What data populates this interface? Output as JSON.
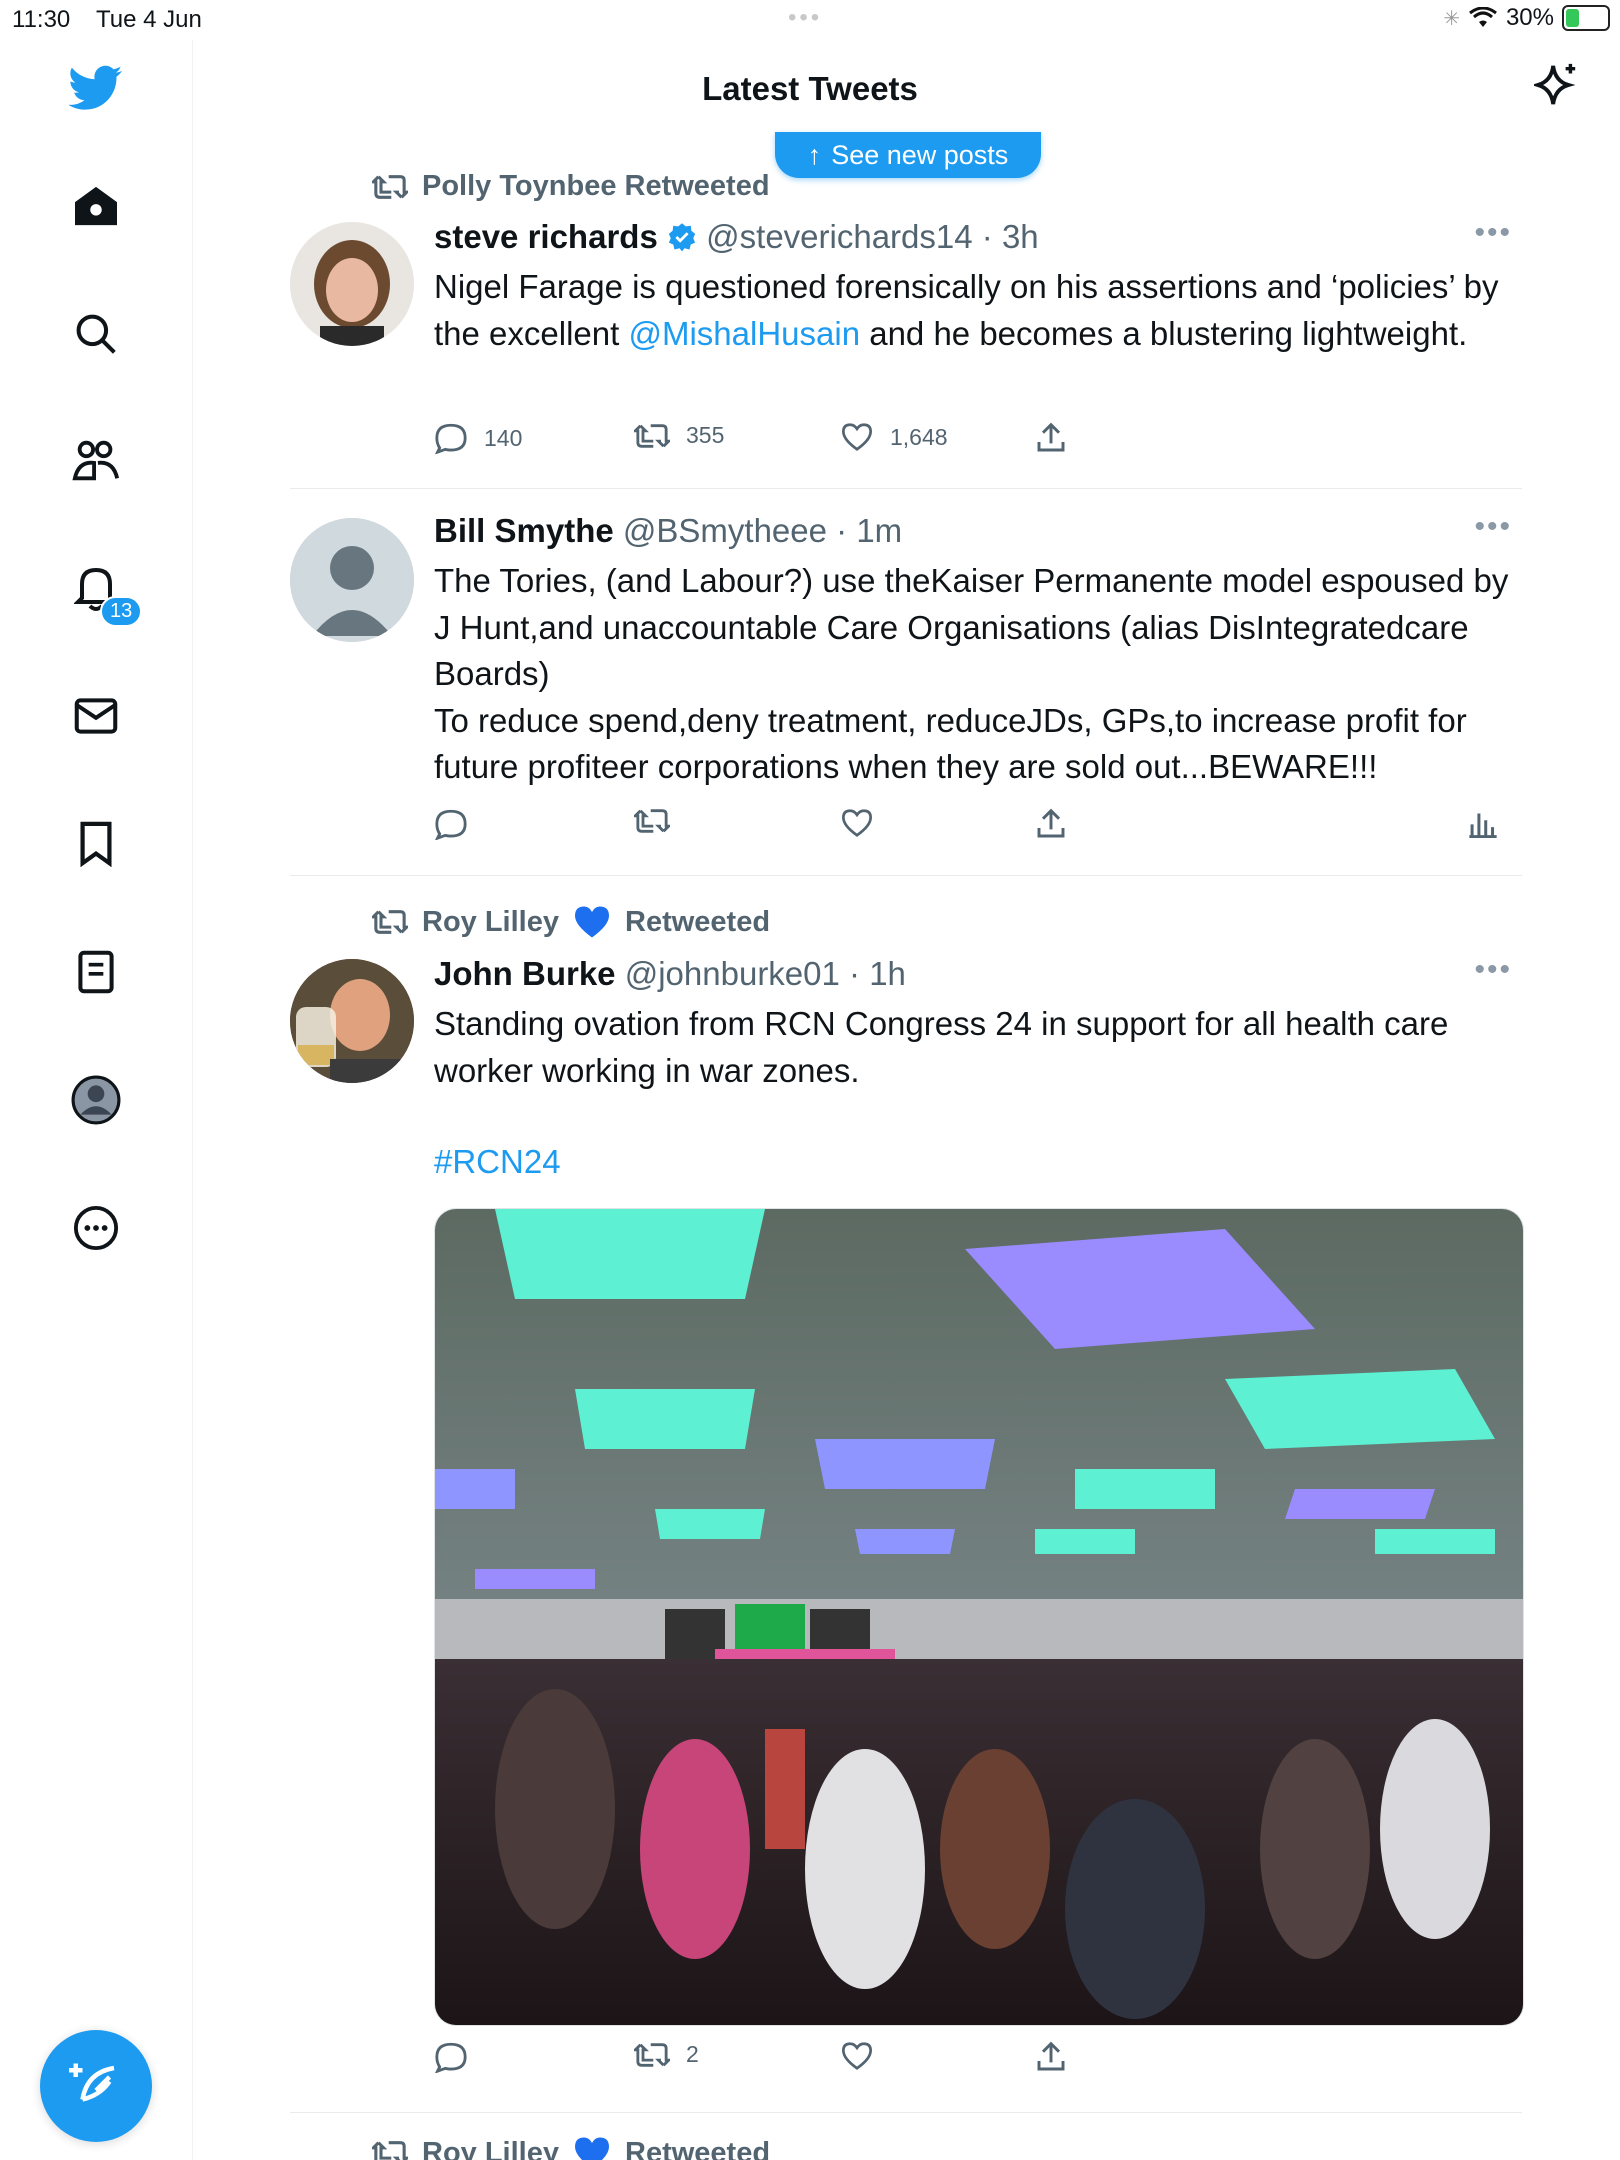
{
  "status": {
    "time": "11:30",
    "date": "Tue 4 Jun",
    "battery": "30%",
    "battery_level": 0.3
  },
  "header": {
    "title": "Latest Tweets",
    "new_posts": "See new posts"
  },
  "sidebar": {
    "notifications_badge": "13",
    "icons": [
      "twitter-logo-icon",
      "home-icon",
      "search-icon",
      "communities-icon",
      "notifications-icon",
      "messages-icon",
      "bookmarks-icon",
      "lists-icon",
      "profile-icon",
      "more-icon"
    ]
  },
  "colors": {
    "accent": "#1d9bf0",
    "secondary_text": "#536471",
    "text": "#0f1419"
  },
  "tweets": [
    {
      "retweeted_by": "Polly Toynbee Retweeted",
      "name": "steve richards",
      "verified": true,
      "handle": "@steverichards14",
      "time": "· 3h",
      "body_pre": "Nigel Farage is questioned forensically on his assertions and ‘policies’ by the excellent ",
      "mention": "@MishalHusain",
      "body_post": " and he becomes a blustering lightweight.",
      "replies": "140",
      "retweets": "355",
      "likes": "1,648"
    },
    {
      "name": "Bill Smythe",
      "handle": "@BSmytheee",
      "time": "· 1m",
      "body_pre": "The Tories, (and Labour?) use theKaiser Permanente model espoused by J Hunt,and unaccountable Care Organisations (alias DisIntegratedcare Boards)\nTo reduce spend,deny treatment, reduceJDs, GPs,to increase profit for future profiteer corporations when they are sold out...BEWARE!!!",
      "replies": "",
      "retweets": "",
      "likes": ""
    },
    {
      "retweeted_by_name": "Roy Lilley",
      "retweeted_by_suffix": "Retweeted",
      "name": "John Burke",
      "handle": "@johnburke01",
      "time": "· 1h",
      "body_pre": "Standing ovation from   RCN Congress 24 in support for all health care worker working in war zones.",
      "hashtag": "#RCN24",
      "replies": "",
      "retweets": "2",
      "likes": ""
    },
    {
      "retweeted_by_name": "Roy Lilley",
      "retweeted_by_suffix": "Retweeted"
    }
  ]
}
